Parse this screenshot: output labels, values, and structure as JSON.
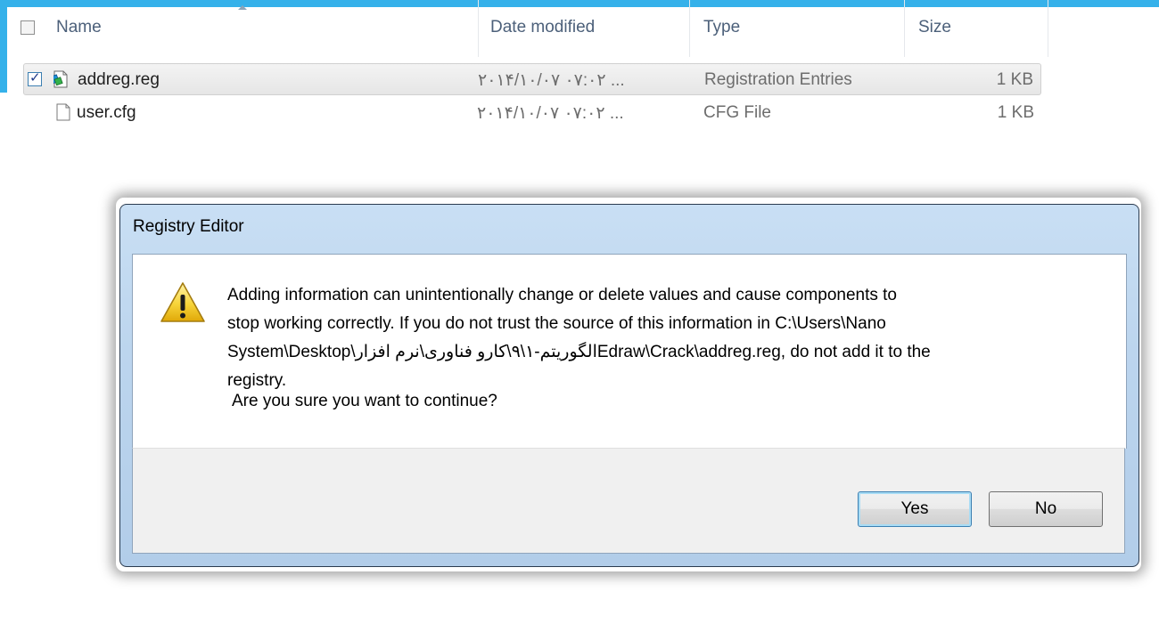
{
  "explorer": {
    "columns": {
      "name": "Name",
      "date_modified": "Date modified",
      "type": "Type",
      "size": "Size"
    },
    "files": [
      {
        "name": "addreg.reg",
        "date": "۲۰۱۴/۱۰/۰۷ ۰۷:۰۲ ...",
        "type": "Registration Entries",
        "size": "1 KB",
        "icon": "registry-file-icon",
        "selected": true,
        "checked": true
      },
      {
        "name": "user.cfg",
        "date": "۲۰۱۴/۱۰/۰۷ ۰۷:۰۲ ...",
        "type": "CFG File",
        "size": "1 KB",
        "icon": "blank-file-icon",
        "selected": false,
        "checked": false
      }
    ]
  },
  "dialog": {
    "title": "Registry Editor",
    "message_line1": "Adding information can unintentionally change or delete values and cause components to",
    "message_line2": "stop working correctly. If you do not trust the source of this information in C:\\Users\\Nano",
    "message_line3": "System\\Desktop\\الگوریتم-۱\\۹\\کارو فناوری\\نرم افزارEdraw\\Crack\\addreg.reg, do not add it to the",
    "message_line4": "registry.",
    "confirm": "Are you sure you want to continue?",
    "yes_label": "Yes",
    "no_label": "No",
    "icon": "warning-icon"
  },
  "colors": {
    "accent": "#35b1ea",
    "dialog_frame": "#bcd5ee",
    "default_button_border": "#3c7fb1"
  }
}
